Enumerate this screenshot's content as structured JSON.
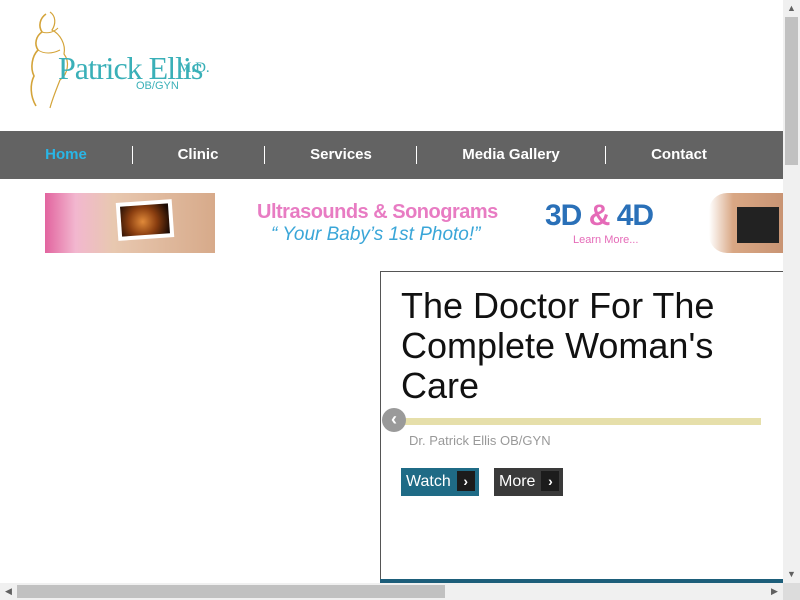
{
  "logo": {
    "name": "Patrick Ellis",
    "suffix": "M.D.",
    "subtitle": "OB/GYN",
    "icon": "pregnant-woman-silhouette-icon",
    "colors": {
      "text": "#3ab0b8",
      "figure": "#d4a43a"
    }
  },
  "nav": {
    "items": [
      {
        "label": "Home",
        "active": true
      },
      {
        "label": "Clinic"
      },
      {
        "label": "Services"
      },
      {
        "label": "Media Gallery"
      },
      {
        "label": "Contact"
      }
    ],
    "colors": {
      "background": "#636363",
      "active": "#29b6e6",
      "text": "#ffffff"
    }
  },
  "banner": {
    "title": "Ultrasounds & Sonograms",
    "tagline": "“ Your Baby’s 1st Photo!”",
    "cta_main_a": "3D",
    "cta_amp": "&",
    "cta_main_b": "4D",
    "cta_sub": "Learn More..."
  },
  "slide": {
    "heading": "The Doctor For The Complete Woman's Care",
    "subtitle": "Dr. Patrick Ellis OB/GYN",
    "buttons": {
      "watch": "Watch",
      "more": "More"
    },
    "prev_icon": "chevron-left-icon",
    "arrow_icon": "chevron-right-icon",
    "colors": {
      "watch": "#1f6b86",
      "more": "#3a3a3a",
      "line": "#e6dfaa"
    }
  },
  "icons": {
    "prev": "‹",
    "next_arrow": "›",
    "scroll_up": "▲",
    "scroll_down": "▼",
    "scroll_left": "◀",
    "scroll_right": "▶"
  }
}
